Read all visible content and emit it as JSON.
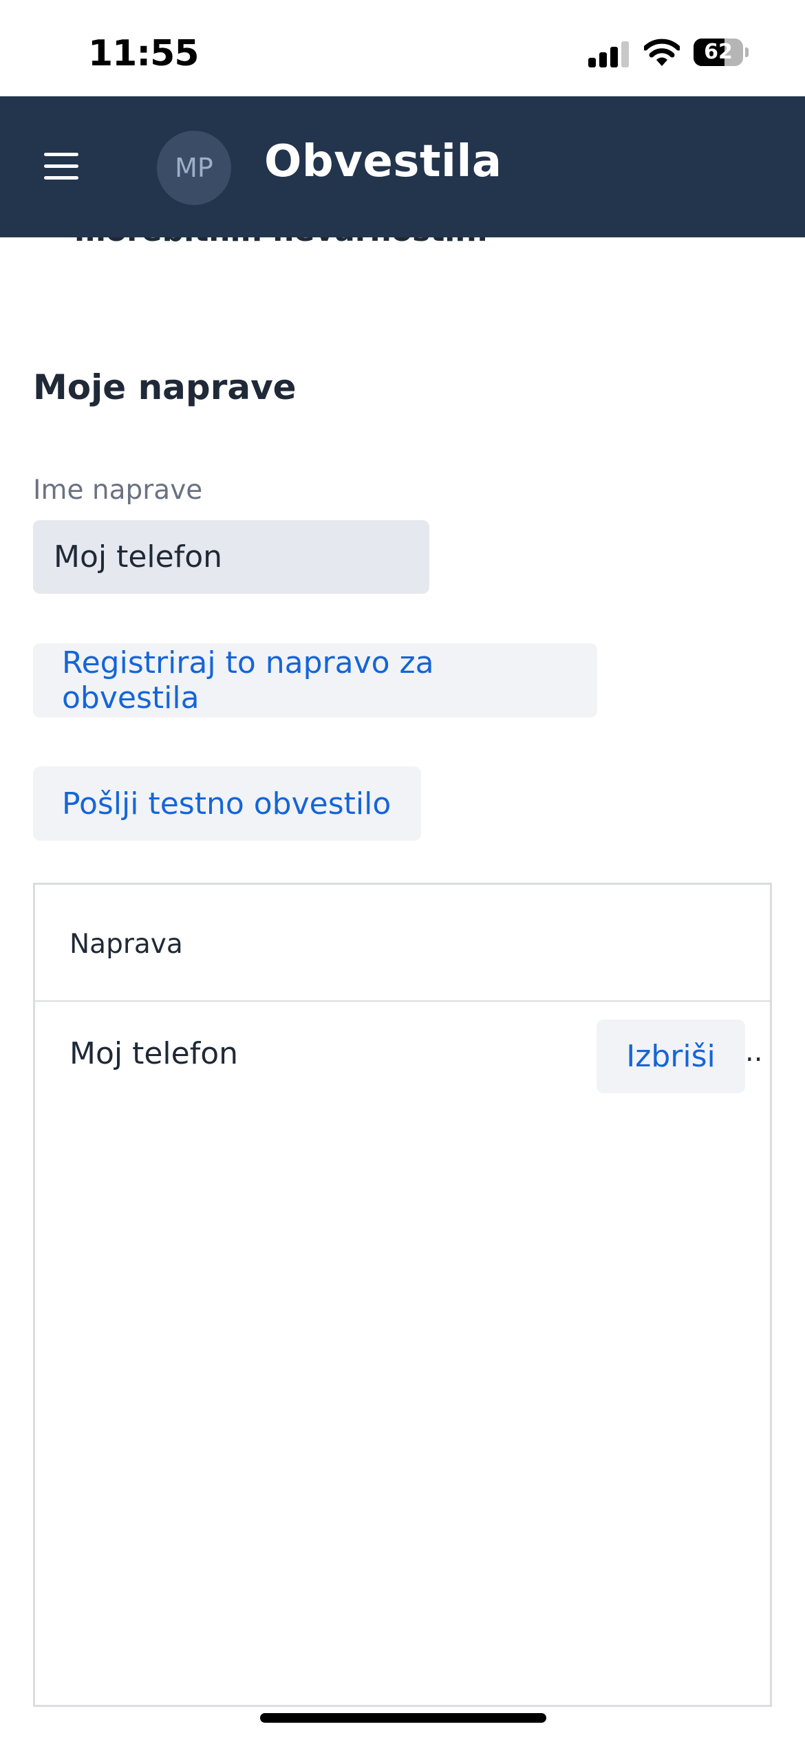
{
  "status_bar": {
    "time": "11:55",
    "battery_percent": "62",
    "battery_level": 0.62,
    "signal_icon": "cellular-signal-icon",
    "wifi_icon": "wifi-icon"
  },
  "header": {
    "menu_icon": "hamburger-menu-icon",
    "avatar_initials": "MP",
    "title": "Obvestila",
    "background_color": "#23344d"
  },
  "page": {
    "clipped_text": "morebitnih nevarnostih.",
    "section_title": "Moje naprave",
    "device_name_label": "Ime naprave",
    "device_name_value": "Moj telefon",
    "register_button_label": "Registriraj to napravo za obvestila",
    "test_button_label": "Pošlji testno obvestilo",
    "accent_color": "#1565d8"
  },
  "devices_table": {
    "column_header": "Naprava",
    "rows": [
      {
        "name": "Moj telefon",
        "action_label": "Izbriši",
        "overflow": ".."
      }
    ]
  }
}
